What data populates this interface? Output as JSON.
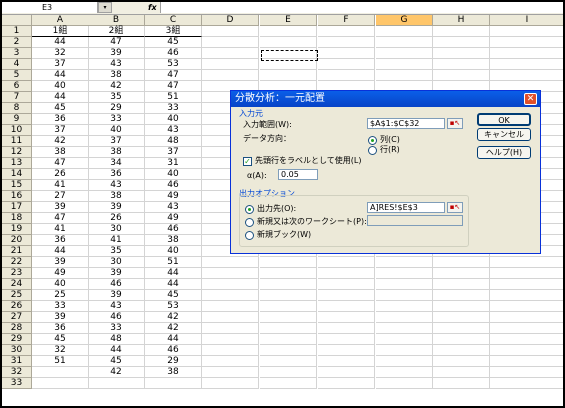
{
  "namebox": {
    "value": "E3",
    "dropdown_icon": "▾"
  },
  "formula": {
    "fx_label": "fx",
    "content": ""
  },
  "columns": [
    "A",
    "B",
    "C",
    "D",
    "E",
    "F",
    "G",
    "H",
    "I"
  ],
  "selected_column": "G",
  "rows": [
    "1",
    "2",
    "3",
    "4",
    "5",
    "6",
    "7",
    "8",
    "9",
    "10",
    "11",
    "12",
    "13",
    "14",
    "15",
    "16",
    "17",
    "18",
    "19",
    "20",
    "21",
    "22",
    "23",
    "24",
    "25",
    "26",
    "27",
    "28",
    "29",
    "30",
    "31",
    "32",
    "33"
  ],
  "cells": [
    [
      "1組",
      "2組",
      "3組"
    ],
    [
      "44",
      "47",
      "45"
    ],
    [
      "32",
      "39",
      "46"
    ],
    [
      "37",
      "43",
      "53"
    ],
    [
      "44",
      "38",
      "47"
    ],
    [
      "40",
      "42",
      "47"
    ],
    [
      "44",
      "35",
      "51"
    ],
    [
      "45",
      "29",
      "33"
    ],
    [
      "36",
      "33",
      "40"
    ],
    [
      "37",
      "40",
      "43"
    ],
    [
      "42",
      "37",
      "48"
    ],
    [
      "38",
      "38",
      "37"
    ],
    [
      "47",
      "34",
      "31"
    ],
    [
      "26",
      "36",
      "40"
    ],
    [
      "41",
      "43",
      "46"
    ],
    [
      "27",
      "38",
      "49"
    ],
    [
      "39",
      "39",
      "43"
    ],
    [
      "47",
      "26",
      "49"
    ],
    [
      "41",
      "30",
      "46"
    ],
    [
      "36",
      "41",
      "38"
    ],
    [
      "44",
      "35",
      "40"
    ],
    [
      "39",
      "30",
      "51"
    ],
    [
      "49",
      "39",
      "44"
    ],
    [
      "40",
      "46",
      "44"
    ],
    [
      "25",
      "39",
      "45"
    ],
    [
      "33",
      "43",
      "53"
    ],
    [
      "39",
      "46",
      "42"
    ],
    [
      "36",
      "33",
      "42"
    ],
    [
      "45",
      "48",
      "44"
    ],
    [
      "32",
      "44",
      "46"
    ],
    [
      "51",
      "45",
      "29"
    ],
    [
      "",
      "42",
      "38"
    ]
  ],
  "dialog": {
    "title": "分散分析：一元配置",
    "close_icon": "✕",
    "input_section": "入力元",
    "input_range_label": "入力範囲(W):",
    "input_range_value": "$A$1:$C$32",
    "direction_label": "データ方向：",
    "direction_col": "列(C)",
    "direction_row": "行(R)",
    "labels_checkbox": "先頭行をラベルとして使用(L)",
    "alpha_label": "α(A):",
    "alpha_value": "0.05",
    "output_section": "出力オプション",
    "output_dest": "出力先(O):",
    "output_dest_value": "A]RES!$E$3",
    "new_sheet": "新規又は次のワークシート(P):",
    "new_sheet_value": "",
    "new_book": "新規ブック(W)",
    "ok": "OK",
    "cancel": "キャンセル",
    "help": "ヘルプ(H)",
    "ref_icon": "range-select-icon"
  }
}
